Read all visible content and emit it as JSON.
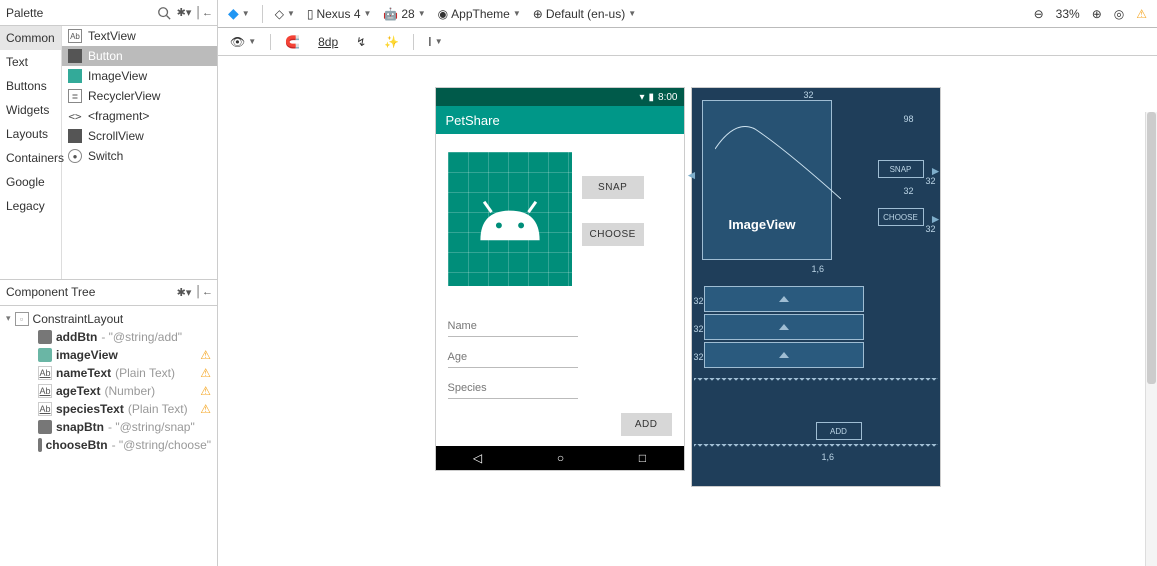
{
  "palette": {
    "title": "Palette",
    "categories": [
      "Common",
      "Text",
      "Buttons",
      "Widgets",
      "Layouts",
      "Containers",
      "Google",
      "Legacy"
    ],
    "selectedCategory": "Common",
    "items": [
      "TextView",
      "Button",
      "ImageView",
      "RecyclerView",
      "<fragment>",
      "ScrollView",
      "Switch"
    ],
    "selectedItem": "Button"
  },
  "tree": {
    "title": "Component Tree",
    "root": "ConstraintLayout",
    "nodes": [
      {
        "name": "addBtn",
        "hint": "- \"@string/add\"",
        "warn": false,
        "icon": "btn"
      },
      {
        "name": "imageView",
        "hint": "",
        "warn": true,
        "icon": "img"
      },
      {
        "name": "nameText",
        "hint": "(Plain Text)",
        "warn": true,
        "icon": "ab"
      },
      {
        "name": "ageText",
        "hint": "(Number)",
        "warn": true,
        "icon": "ab"
      },
      {
        "name": "speciesText",
        "hint": "(Plain Text)",
        "warn": true,
        "icon": "ab"
      },
      {
        "name": "snapBtn",
        "hint": "- \"@string/snap\"",
        "warn": false,
        "icon": "btn"
      },
      {
        "name": "chooseBtn",
        "hint": "- \"@string/choose\"",
        "warn": false,
        "icon": "btn"
      }
    ]
  },
  "toolbar": {
    "device": "Nexus 4",
    "api": "28",
    "theme": "AppTheme",
    "locale": "Default (en-us)",
    "zoom": "33%"
  },
  "subbar": {
    "dp": "8dp"
  },
  "device_preview": {
    "time": "8:00",
    "appTitle": "PetShare",
    "snap": "SNAP",
    "choose": "CHOOSE",
    "add": "ADD",
    "fields": [
      "Name",
      "Age",
      "Species"
    ]
  },
  "blueprint": {
    "imgLabel": "ImageView",
    "snap": "SNAP",
    "choose": "CHOOSE",
    "add": "ADD",
    "m32": "32",
    "m98": "98",
    "m16a": "1,6",
    "m16b": "1,6"
  }
}
